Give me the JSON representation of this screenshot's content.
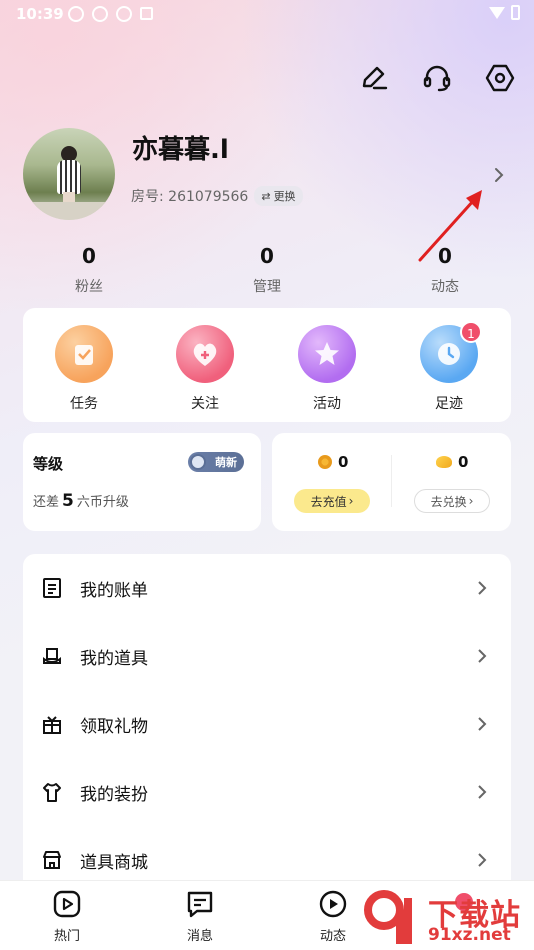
{
  "status_bar": {
    "time": "10:39"
  },
  "header": {
    "icons": [
      "edit-icon",
      "headset-icon",
      "settings-icon"
    ]
  },
  "profile": {
    "username": "亦暮暮.l",
    "room_label": "房号: 261079566",
    "switch_label": "更换"
  },
  "stats": [
    {
      "value": "0",
      "label": "粉丝"
    },
    {
      "value": "0",
      "label": "管理"
    },
    {
      "value": "0",
      "label": "动态"
    }
  ],
  "quick_actions": [
    {
      "label": "任务",
      "icon": "task-icon",
      "color": "#f7a35c"
    },
    {
      "label": "关注",
      "icon": "heart-icon",
      "color": "#f0607c"
    },
    {
      "label": "活动",
      "icon": "star-icon",
      "color": "#b26df0"
    },
    {
      "label": "足迹",
      "icon": "clock-icon",
      "color": "#5aa8f2",
      "badge": "1"
    }
  ],
  "level": {
    "title": "等级",
    "badge": "萌新",
    "note_prefix": "还差",
    "note_value": "5",
    "note_suffix": "六币升级"
  },
  "wallet": {
    "coin_value": "0",
    "bean_value": "0",
    "recharge_label": "去充值",
    "exchange_label": "去兑换"
  },
  "menu": [
    {
      "label": "我的账单",
      "icon": "receipt-icon"
    },
    {
      "label": "我的道具",
      "icon": "hat-icon"
    },
    {
      "label": "领取礼物",
      "icon": "gift-icon"
    },
    {
      "label": "我的装扮",
      "icon": "shirt-icon"
    },
    {
      "label": "道具商城",
      "icon": "store-icon"
    }
  ],
  "bottom_nav": [
    {
      "label": "热门",
      "icon": "play-square-icon"
    },
    {
      "label": "消息",
      "icon": "message-icon"
    },
    {
      "label": "动态",
      "icon": "play-circle-icon"
    }
  ],
  "watermark": {
    "line1": "下载站",
    "line2": "91xz.net"
  },
  "colors": {
    "accent_red": "#f04e6a",
    "recharge_yellow": "#fbe98d",
    "level_badge": "#5b6f96"
  }
}
